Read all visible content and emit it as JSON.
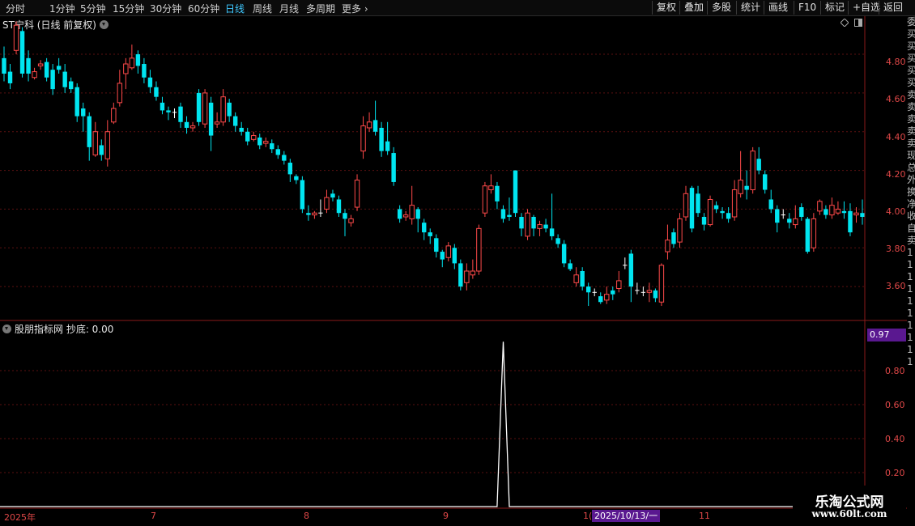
{
  "toolbar": {
    "periods": [
      "分时",
      "1分钟",
      "5分钟",
      "15分钟",
      "30分钟",
      "60分钟",
      "日线",
      "周线",
      "月线",
      "多周期",
      "更多"
    ],
    "active_period": "日线",
    "tools": [
      "复权",
      "叠加",
      "多股",
      "统计",
      "画线",
      "F10",
      "标记",
      "+自选",
      "返回"
    ]
  },
  "main": {
    "title": "ST宁科 (日线 前复权)",
    "price_axis": [
      "4.80",
      "4.60",
      "4.40",
      "4.20",
      "4.00",
      "3.80",
      "3.60"
    ]
  },
  "indicator": {
    "title": "股朋指标网 抄底: 0.00",
    "axis": [
      "0.80",
      "0.60",
      "0.40",
      "0.20"
    ],
    "current_value": "0.97"
  },
  "dates": {
    "labels": [
      "2025年",
      "7",
      "8",
      "9",
      "1(",
      "11"
    ],
    "cursor": "2025/10/13/一"
  },
  "right_strip": [
    "委",
    "买",
    "买",
    "买",
    "买",
    "买",
    "卖",
    "卖",
    "卖",
    "卖",
    "卖",
    "现",
    "总",
    "外",
    "换",
    "净",
    "收",
    "自",
    "卖",
    "1",
    "1",
    "1",
    "1",
    "1",
    "1",
    "1",
    "1",
    "1",
    "1"
  ],
  "watermark": {
    "line1": "乐淘公式网",
    "line2": "www.60lt.com"
  },
  "colors": {
    "up": "#ff4a4a",
    "down": "#00e5f0",
    "indicator_line": "#ffffff",
    "highlight": "#5a1890"
  },
  "chart_data": {
    "type": "candlestick",
    "title": "ST宁科 (日线 前复权)",
    "ylim": [
      3.45,
      4.98
    ],
    "yticks": [
      3.6,
      3.8,
      4.0,
      4.2,
      4.4,
      4.6,
      4.8
    ],
    "candles": [
      [
        4.78,
        4.7,
        4.84,
        4.66
      ],
      [
        4.71,
        4.65,
        4.75,
        4.62
      ],
      [
        4.82,
        4.95,
        4.97,
        4.8
      ],
      [
        4.92,
        4.7,
        4.94,
        4.68
      ],
      [
        4.78,
        4.7,
        4.82,
        4.66
      ],
      [
        4.68,
        4.71,
        4.73,
        4.67
      ],
      [
        4.74,
        4.75,
        4.77,
        4.72
      ],
      [
        4.76,
        4.68,
        4.78,
        4.66
      ],
      [
        4.72,
        4.62,
        4.75,
        4.59
      ],
      [
        4.74,
        4.72,
        4.78,
        4.7
      ],
      [
        4.71,
        4.63,
        4.75,
        4.6
      ],
      [
        4.66,
        4.62,
        4.68,
        4.6
      ],
      [
        4.63,
        4.48,
        4.65,
        4.45
      ],
      [
        4.52,
        4.48,
        4.55,
        4.4
      ],
      [
        4.48,
        4.32,
        4.5,
        4.25
      ],
      [
        4.28,
        4.4,
        4.45,
        4.27
      ],
      [
        4.33,
        4.28,
        4.36,
        4.25
      ],
      [
        4.26,
        4.4,
        4.46,
        4.22
      ],
      [
        4.45,
        4.52,
        4.55,
        4.44
      ],
      [
        4.55,
        4.65,
        4.72,
        4.53
      ],
      [
        4.7,
        4.75,
        4.78,
        4.62
      ],
      [
        4.73,
        4.78,
        4.85,
        4.72
      ],
      [
        4.8,
        4.74,
        4.82,
        4.7
      ],
      [
        4.75,
        4.68,
        4.78,
        4.65
      ],
      [
        4.68,
        4.63,
        4.72,
        4.6
      ],
      [
        4.63,
        4.58,
        4.66,
        4.56
      ],
      [
        4.55,
        4.51,
        4.58,
        4.49
      ],
      [
        4.51,
        4.5,
        4.53,
        4.46
      ],
      [
        4.5,
        4.5,
        4.52,
        4.47
      ],
      [
        4.53,
        4.45,
        4.55,
        4.42
      ],
      [
        4.45,
        4.42,
        4.48,
        4.39
      ],
      [
        4.42,
        4.43,
        4.45,
        4.4
      ],
      [
        4.6,
        4.45,
        4.62,
        4.43
      ],
      [
        4.44,
        4.6,
        4.62,
        4.42
      ],
      [
        4.55,
        4.38,
        4.58,
        4.3
      ],
      [
        4.44,
        4.45,
        4.5,
        4.42
      ],
      [
        4.45,
        4.58,
        4.62,
        4.43
      ],
      [
        4.55,
        4.48,
        4.57,
        4.45
      ],
      [
        4.48,
        4.43,
        4.5,
        4.4
      ],
      [
        4.42,
        4.4,
        4.45,
        4.38
      ],
      [
        4.4,
        4.35,
        4.42,
        4.33
      ],
      [
        4.36,
        4.38,
        4.4,
        4.35
      ],
      [
        4.37,
        4.33,
        4.39,
        4.31
      ],
      [
        4.34,
        4.35,
        4.37,
        4.32
      ],
      [
        4.34,
        4.31,
        4.36,
        4.29
      ],
      [
        4.31,
        4.28,
        4.33,
        4.26
      ],
      [
        4.28,
        4.25,
        4.3,
        4.23
      ],
      [
        4.24,
        4.18,
        4.26,
        4.14
      ],
      [
        4.17,
        4.15,
        4.18,
        4.13
      ],
      [
        4.15,
        4.0,
        4.17,
        3.98
      ],
      [
        3.98,
        3.97,
        4.02,
        3.94
      ],
      [
        3.97,
        3.98,
        3.99,
        3.95
      ],
      [
        3.98,
        3.98,
        4.05,
        3.96
      ],
      [
        4.0,
        4.06,
        4.1,
        3.98
      ],
      [
        4.08,
        4.06,
        4.1,
        4.04
      ],
      [
        4.05,
        3.98,
        4.07,
        3.96
      ],
      [
        3.98,
        3.95,
        4.0,
        3.86
      ],
      [
        3.93,
        3.95,
        3.97,
        3.91
      ],
      [
        4.01,
        4.15,
        4.18,
        3.99
      ],
      [
        4.3,
        4.43,
        4.48,
        4.26
      ],
      [
        4.42,
        4.45,
        4.5,
        4.4
      ],
      [
        4.46,
        4.4,
        4.56,
        4.38
      ],
      [
        4.42,
        4.3,
        4.45,
        4.27
      ],
      [
        4.35,
        4.3,
        4.45,
        4.28
      ],
      [
        4.29,
        4.14,
        4.32,
        4.12
      ],
      [
        4.0,
        3.95,
        4.02,
        3.93
      ],
      [
        3.96,
        3.97,
        3.99,
        3.94
      ],
      [
        3.95,
        4.02,
        4.12,
        3.92
      ],
      [
        4.0,
        3.95,
        4.01,
        3.88
      ],
      [
        3.93,
        3.88,
        3.95,
        3.84
      ],
      [
        3.88,
        3.86,
        3.9,
        3.82
      ],
      [
        3.85,
        3.78,
        3.87,
        3.75
      ],
      [
        3.78,
        3.74,
        3.79,
        3.7
      ],
      [
        3.75,
        3.81,
        3.83,
        3.73
      ],
      [
        3.8,
        3.72,
        3.82,
        3.69
      ],
      [
        3.72,
        3.6,
        3.74,
        3.58
      ],
      [
        3.62,
        3.68,
        3.72,
        3.58
      ],
      [
        3.66,
        3.68,
        3.74,
        3.64
      ],
      [
        3.68,
        3.9,
        3.92,
        3.66
      ],
      [
        3.98,
        4.12,
        4.14,
        3.96
      ],
      [
        4.1,
        4.12,
        4.18,
        4.08
      ],
      [
        4.12,
        4.04,
        4.14,
        4.0
      ],
      [
        4.0,
        3.95,
        4.02,
        3.93
      ],
      [
        3.97,
        3.96,
        4.06,
        3.94
      ],
      [
        4.2,
        3.98,
        4.2,
        3.96
      ],
      [
        3.96,
        3.9,
        3.98,
        3.86
      ],
      [
        3.86,
        3.98,
        4.0,
        3.84
      ],
      [
        3.96,
        3.9,
        3.97,
        3.86
      ],
      [
        3.9,
        3.92,
        3.94,
        3.86
      ],
      [
        3.92,
        3.9,
        3.95,
        3.88
      ],
      [
        3.9,
        3.86,
        4.08,
        3.84
      ],
      [
        3.85,
        3.82,
        3.87,
        3.8
      ],
      [
        3.82,
        3.72,
        3.84,
        3.7
      ],
      [
        3.72,
        3.69,
        3.74,
        3.68
      ],
      [
        3.62,
        3.66,
        3.7,
        3.6
      ],
      [
        3.68,
        3.6,
        3.7,
        3.58
      ],
      [
        3.6,
        3.57,
        3.62,
        3.5
      ],
      [
        3.57,
        3.57,
        3.59,
        3.55
      ],
      [
        3.55,
        3.52,
        3.57,
        3.51
      ],
      [
        3.53,
        3.56,
        3.6,
        3.51
      ],
      [
        3.58,
        3.56,
        3.6,
        3.53
      ],
      [
        3.59,
        3.63,
        3.68,
        3.57
      ],
      [
        3.71,
        3.71,
        3.75,
        3.69
      ],
      [
        3.77,
        3.6,
        3.79,
        3.52
      ],
      [
        3.58,
        3.58,
        3.62,
        3.56
      ],
      [
        3.57,
        3.57,
        3.6,
        3.55
      ],
      [
        3.57,
        3.58,
        3.62,
        3.52
      ],
      [
        3.58,
        3.54,
        3.59,
        3.52
      ],
      [
        3.52,
        3.71,
        3.72,
        3.5
      ],
      [
        3.78,
        3.84,
        3.92,
        3.74
      ],
      [
        3.88,
        3.82,
        3.9,
        3.8
      ],
      [
        3.83,
        3.95,
        3.98,
        3.8
      ],
      [
        3.96,
        4.08,
        4.12,
        3.94
      ],
      [
        4.11,
        3.9,
        4.12,
        3.88
      ],
      [
        4.08,
        3.98,
        4.12,
        3.96
      ],
      [
        3.96,
        3.92,
        3.98,
        3.89
      ],
      [
        3.92,
        4.05,
        4.07,
        3.91
      ],
      [
        4.02,
        4.0,
        4.04,
        3.98
      ],
      [
        3.99,
        3.98,
        4.01,
        3.95
      ],
      [
        3.98,
        3.95,
        4.01,
        3.93
      ],
      [
        3.96,
        4.1,
        4.15,
        3.94
      ],
      [
        4.08,
        4.15,
        4.3,
        4.06
      ],
      [
        4.12,
        4.1,
        4.2,
        4.05
      ],
      [
        4.1,
        4.3,
        4.32,
        4.08
      ],
      [
        4.26,
        4.2,
        4.32,
        4.18
      ],
      [
        4.18,
        4.1,
        4.2,
        4.08
      ],
      [
        4.05,
        4.0,
        4.1,
        3.98
      ],
      [
        4.0,
        3.93,
        4.02,
        3.88
      ],
      [
        3.97,
        3.97,
        4.0,
        3.95
      ],
      [
        3.95,
        3.93,
        3.98,
        3.9
      ],
      [
        3.92,
        3.95,
        4.02,
        3.9
      ],
      [
        4.01,
        3.96,
        4.03,
        3.94
      ],
      [
        3.95,
        3.78,
        3.96,
        3.77
      ],
      [
        3.8,
        3.95,
        3.98,
        3.78
      ],
      [
        3.99,
        4.04,
        4.05,
        3.97
      ],
      [
        4.0,
        3.97,
        4.02,
        3.95
      ],
      [
        3.97,
        4.02,
        4.06,
        3.95
      ],
      [
        3.98,
        4.0,
        4.04,
        3.97
      ],
      [
        3.99,
        3.98,
        4.04,
        3.95
      ],
      [
        3.99,
        3.88,
        4.03,
        3.86
      ],
      [
        3.97,
        3.98,
        4.01,
        3.93
      ],
      [
        3.98,
        3.96,
        4.05,
        3.92
      ]
    ],
    "indicator": {
      "name": "抄底",
      "peak_value": 0.97,
      "peak_bar": 82
    }
  }
}
